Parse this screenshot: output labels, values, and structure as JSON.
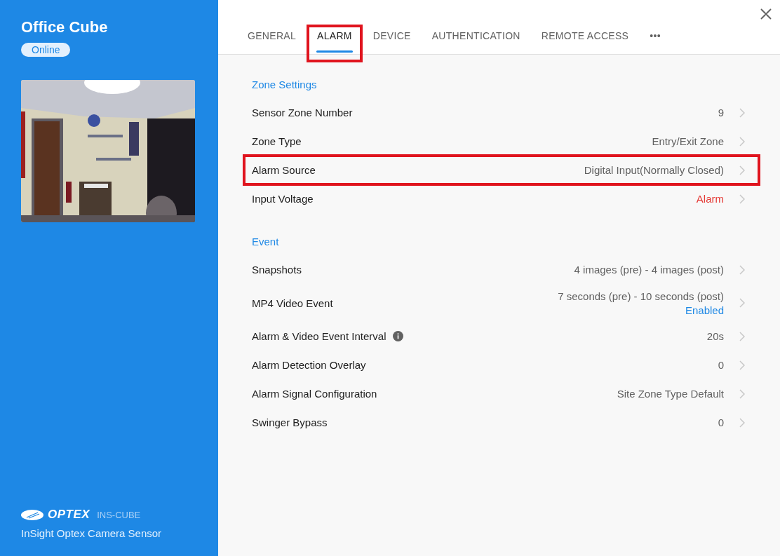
{
  "device": {
    "name": "Office Cube",
    "status": "Online"
  },
  "footer": {
    "brand": "OPTEX",
    "model": "INS-CUBE",
    "subtitle": "InSight Optex Camera Sensor"
  },
  "tabs": [
    {
      "label": "GENERAL",
      "selected": false,
      "highlighted": false
    },
    {
      "label": "ALARM",
      "selected": true,
      "highlighted": true
    },
    {
      "label": "DEVICE",
      "selected": false,
      "highlighted": false
    },
    {
      "label": "AUTHENTICATION",
      "selected": false,
      "highlighted": false
    },
    {
      "label": "REMOTE ACCESS",
      "selected": false,
      "highlighted": false
    },
    {
      "label": "•••",
      "selected": false,
      "highlighted": false
    }
  ],
  "sections": [
    {
      "title": "Zone Settings",
      "rows": [
        {
          "label": "Sensor Zone Number",
          "value": "9",
          "alert": false,
          "info": false,
          "highlighted": false
        },
        {
          "label": "Zone Type",
          "value": "Entry/Exit Zone",
          "alert": false,
          "info": false,
          "highlighted": false
        },
        {
          "label": "Alarm Source",
          "value": "Digital Input(Normally Closed)",
          "alert": false,
          "info": false,
          "highlighted": true
        },
        {
          "label": "Input Voltage",
          "value": "Alarm",
          "alert": true,
          "info": false,
          "highlighted": false
        }
      ]
    },
    {
      "title": "Event",
      "rows": [
        {
          "label": "Snapshots",
          "value": "4 images (pre) - 4 images (post)",
          "alert": false,
          "info": false,
          "highlighted": false
        },
        {
          "label": "MP4 Video Event",
          "value": "7 seconds (pre) - 10 seconds (post)",
          "note": "Enabled",
          "alert": false,
          "info": false,
          "highlighted": false
        },
        {
          "label": "Alarm & Video Event Interval",
          "value": "20s",
          "alert": false,
          "info": true,
          "highlighted": false
        },
        {
          "label": "Alarm Detection Overlay",
          "value": "0",
          "alert": false,
          "info": false,
          "highlighted": false
        },
        {
          "label": "Alarm Signal Configuration",
          "value": "Site Zone Type Default",
          "alert": false,
          "info": false,
          "highlighted": false
        },
        {
          "label": "Swinger Bypass",
          "value": "0",
          "alert": false,
          "info": false,
          "highlighted": false
        }
      ]
    }
  ]
}
